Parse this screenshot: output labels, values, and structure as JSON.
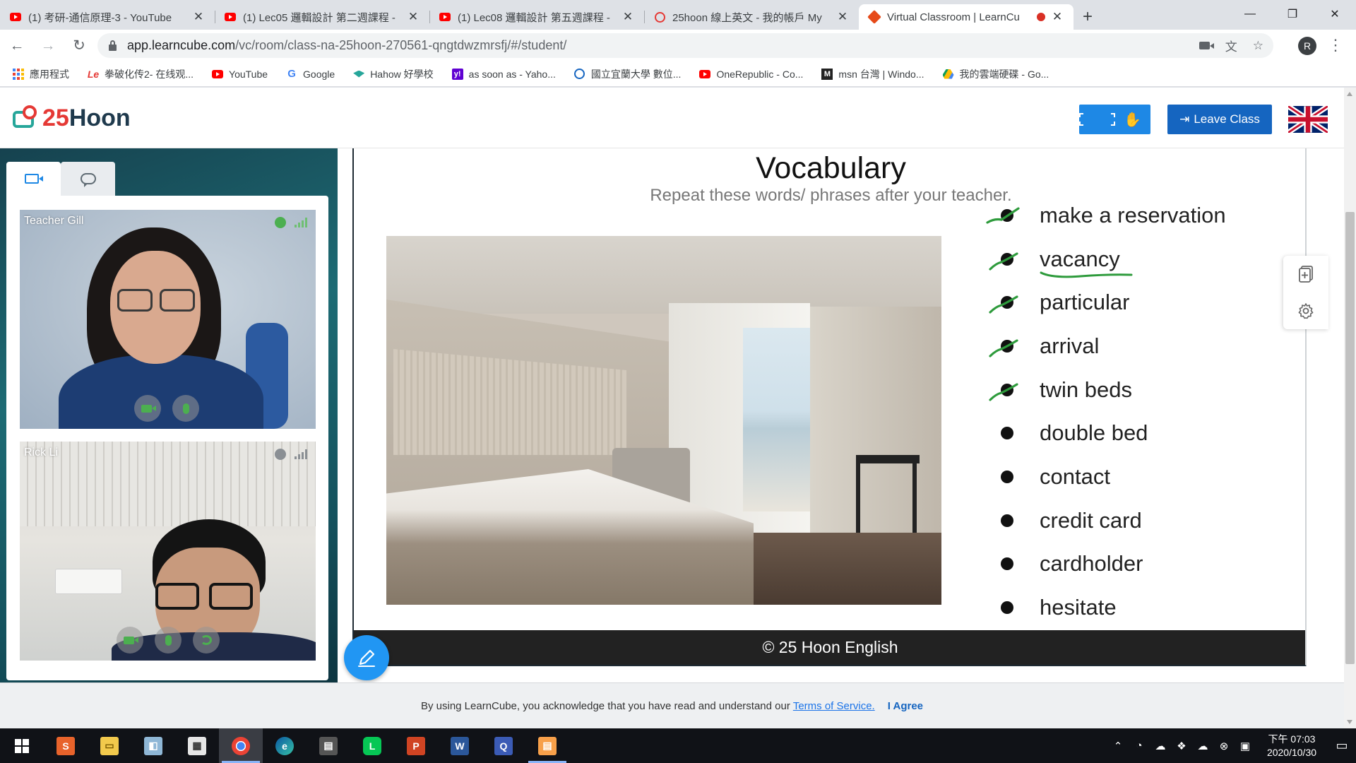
{
  "browser": {
    "tabs": [
      {
        "title": "(1) 考研-通信原理-3 - YouTube",
        "favicon": "youtube-icon"
      },
      {
        "title": "(1) Lec05 邏輯設計 第二週課程 -",
        "favicon": "youtube-icon"
      },
      {
        "title": "(1) Lec08 邏輯設計 第五週課程 -",
        "favicon": "youtube-icon"
      },
      {
        "title": "25hoon 線上英文 - 我的帳戶 My",
        "favicon": "25hoon-icon"
      },
      {
        "title": "Virtual Classroom | LearnCu",
        "favicon": "learncube-icon"
      }
    ],
    "url_host": "app.learncube.com",
    "url_path": "/vc/room/class-na-25hoon-270561-qngtdwzmrsfj/#/student/",
    "profile_initial": "R",
    "bookmarks": [
      {
        "label": "應用程式",
        "icon": "apps-icon"
      },
      {
        "label": "拳破化传2- 在线观...",
        "icon": "le-icon"
      },
      {
        "label": "YouTube",
        "icon": "youtube-icon"
      },
      {
        "label": "Google",
        "icon": "google-icon"
      },
      {
        "label": "Hahow 好學校",
        "icon": "hahow-icon"
      },
      {
        "label": "as soon as - Yaho...",
        "icon": "yahoo-icon"
      },
      {
        "label": "國立宜蘭大學 數位...",
        "icon": "niu-icon"
      },
      {
        "label": "OneRepublic - Co...",
        "icon": "youtube-icon"
      },
      {
        "label": "msn 台灣 | Windo...",
        "icon": "msn-icon"
      },
      {
        "label": "我的雲端硬碟 - Go...",
        "icon": "drive-icon"
      }
    ]
  },
  "header": {
    "logo_number": "25",
    "logo_word": "Hoon",
    "leave_label": "Leave Class"
  },
  "participants": [
    {
      "name": "Teacher Gill",
      "status_color": "#4caf50"
    },
    {
      "name": "Rick Li",
      "status_color": "#8a8f94"
    }
  ],
  "slide": {
    "title": "Vocabulary",
    "subtitle": "Repeat these words/ phrases after your teacher.",
    "items": [
      {
        "text": "make a reservation",
        "checked": true
      },
      {
        "text": "vacancy",
        "checked": true,
        "underlined": true
      },
      {
        "text": "particular",
        "checked": true
      },
      {
        "text": "arrival",
        "checked": true
      },
      {
        "text": "twin beds",
        "checked": true
      },
      {
        "text": "double bed",
        "checked": false
      },
      {
        "text": "contact",
        "checked": false
      },
      {
        "text": "credit card",
        "checked": false
      },
      {
        "text": "cardholder",
        "checked": false
      },
      {
        "text": "hesitate",
        "checked": false
      }
    ],
    "footer": "© 25 Hoon English",
    "annotation_color": "#2e9b3c"
  },
  "consent": {
    "text": "By using LearnCube, you acknowledge that you have read and understand our",
    "link": "Terms of Service.",
    "agree": "I Agree"
  },
  "taskbar": {
    "time": "下午 07:03",
    "date": "2020/10/30"
  },
  "colors": {
    "accent": "#1e88e5",
    "leave_button": "#1565c0"
  }
}
